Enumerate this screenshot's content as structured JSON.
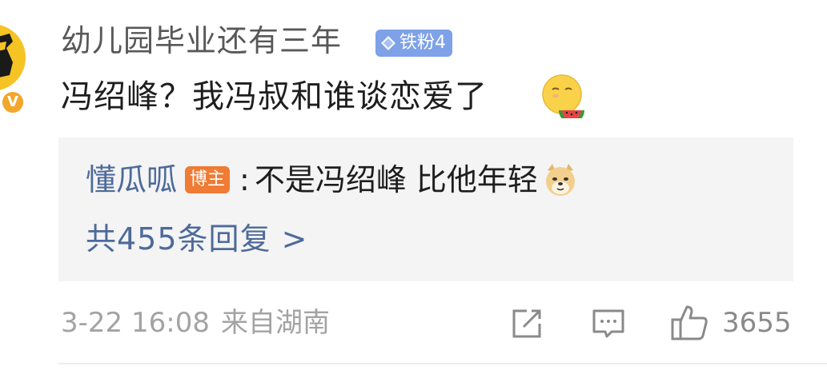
{
  "comment": {
    "username": "幼儿园毕业还有三年",
    "fan_badge": "铁粉4",
    "text": "冯绍峰？我冯叔和谁谈恋爱了",
    "verified_mark": "V"
  },
  "reply": {
    "author": "懂瓜呱",
    "role_tag": "博主",
    "separator": ":",
    "text": "不是冯绍峰 比他年轻",
    "total_replies": "共455条回复 >"
  },
  "meta": {
    "timestamp": "3-22 16:08",
    "location": "来自湖南",
    "like_count": "3655"
  },
  "colors": {
    "link_blue": "#4d6a9a",
    "fan_badge_bg": "#7ea1e8",
    "blogger_tag_bg": "#ef7b34",
    "meta_gray": "#a3a3a3"
  }
}
